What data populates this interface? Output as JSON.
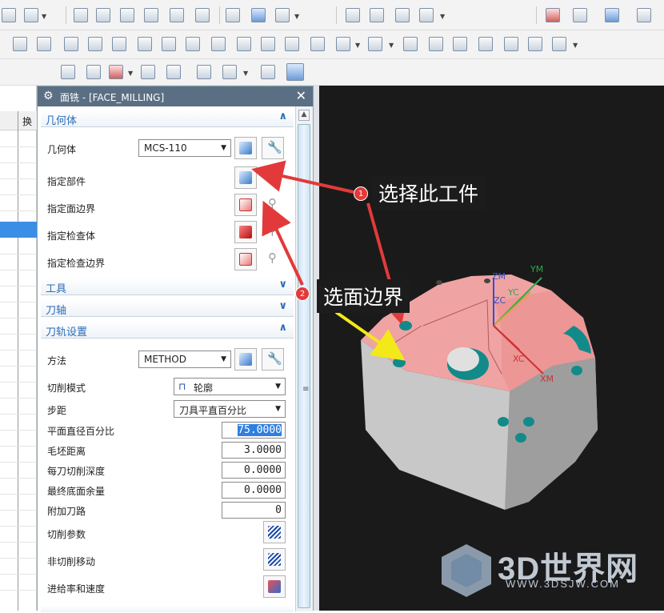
{
  "window": {
    "title": "面铣 - [FACE_MILLING]"
  },
  "left_strip": {
    "header": "换"
  },
  "sections": {
    "geometry": {
      "title": "几何体",
      "geometry_label": "几何体",
      "geometry_value": "MCS-110",
      "specify_part": "指定部件",
      "specify_face_boundary": "指定面边界",
      "specify_check_body": "指定检查体",
      "specify_check_boundary": "指定检查边界"
    },
    "tool": {
      "title": "工具"
    },
    "tool_axis": {
      "title": "刀轴"
    },
    "path_settings": {
      "title": "刀轨设置",
      "method_label": "方法",
      "method_value": "METHOD",
      "cut_pattern_label": "切削模式",
      "cut_pattern_value": "轮廓",
      "stepover_label": "步距",
      "stepover_value": "刀具平直百分比",
      "flat_diameter_label": "平面直径百分比",
      "flat_diameter_value": "75.0000",
      "blank_distance_label": "毛坯距离",
      "blank_distance_value": "3.0000",
      "depth_per_cut_label": "每刀切削深度",
      "depth_per_cut_value": "0.0000",
      "final_floor_stock_label": "最终底面余量",
      "final_floor_stock_value": "0.0000",
      "extra_passes_label": "附加刀路",
      "extra_passes_value": "0",
      "cutting_params": "切削参数",
      "non_cutting_moves": "非切削移动",
      "feeds_speeds": "进给率和速度"
    }
  },
  "annotations": {
    "callout1": {
      "badge": "1",
      "text": "选择此工件"
    },
    "callout2": {
      "badge": "2",
      "text": "选面边界"
    }
  },
  "viewport": {
    "axes": [
      "ZM",
      "ZC",
      "YM",
      "YC",
      "XC",
      "XM"
    ]
  },
  "watermark": {
    "brand": "3D世界网",
    "url": "WWW.3DSJW.COM"
  },
  "colors": {
    "part_face": "#f0a3a3",
    "part_wall": "#c8c8c8",
    "hole": "#138a8a",
    "title_bar": "#5b6f84",
    "accent": "#2b6cb8"
  }
}
